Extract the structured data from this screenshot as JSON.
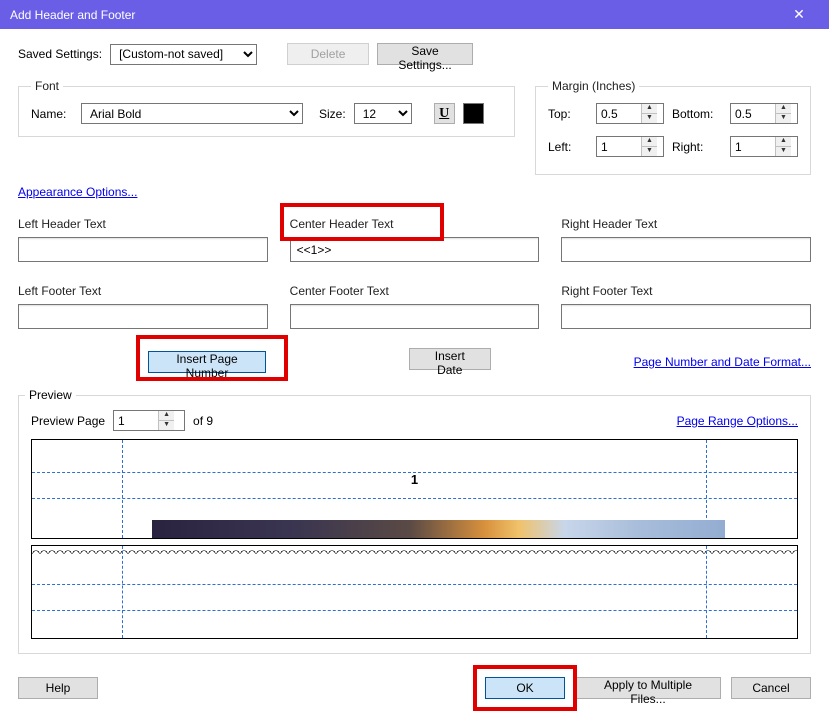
{
  "title": "Add Header and Footer",
  "saved": {
    "label": "Saved Settings:",
    "value": "[Custom-not saved]",
    "delete": "Delete",
    "save": "Save Settings..."
  },
  "font": {
    "legend": "Font",
    "name_label": "Name:",
    "name_value": "Arial Bold",
    "size_label": "Size:",
    "size_value": "12",
    "underline_glyph": "U"
  },
  "margin": {
    "legend": "Margin (Inches)",
    "top_label": "Top:",
    "top_value": "0.5",
    "bottom_label": "Bottom:",
    "bottom_value": "0.5",
    "left_label": "Left:",
    "left_value": "1",
    "right_label": "Right:",
    "right_value": "1"
  },
  "links": {
    "appearance": "Appearance Options...",
    "page_format": "Page Number and Date Format...",
    "page_range": "Page Range Options..."
  },
  "fields": {
    "left_header": "Left Header Text",
    "center_header": "Center Header Text",
    "right_header": "Right Header Text",
    "left_footer": "Left Footer Text",
    "center_footer": "Center Footer Text",
    "right_footer": "Right Footer Text",
    "center_header_value": "<<1>>"
  },
  "actions": {
    "insert_page": "Insert Page Number",
    "insert_date": "Insert Date"
  },
  "preview": {
    "legend": "Preview",
    "page_label": "Preview Page",
    "page_value": "1",
    "of_text": "of 9",
    "shown_number": "1"
  },
  "buttons": {
    "help": "Help",
    "ok": "OK",
    "apply": "Apply to Multiple Files...",
    "cancel": "Cancel"
  }
}
